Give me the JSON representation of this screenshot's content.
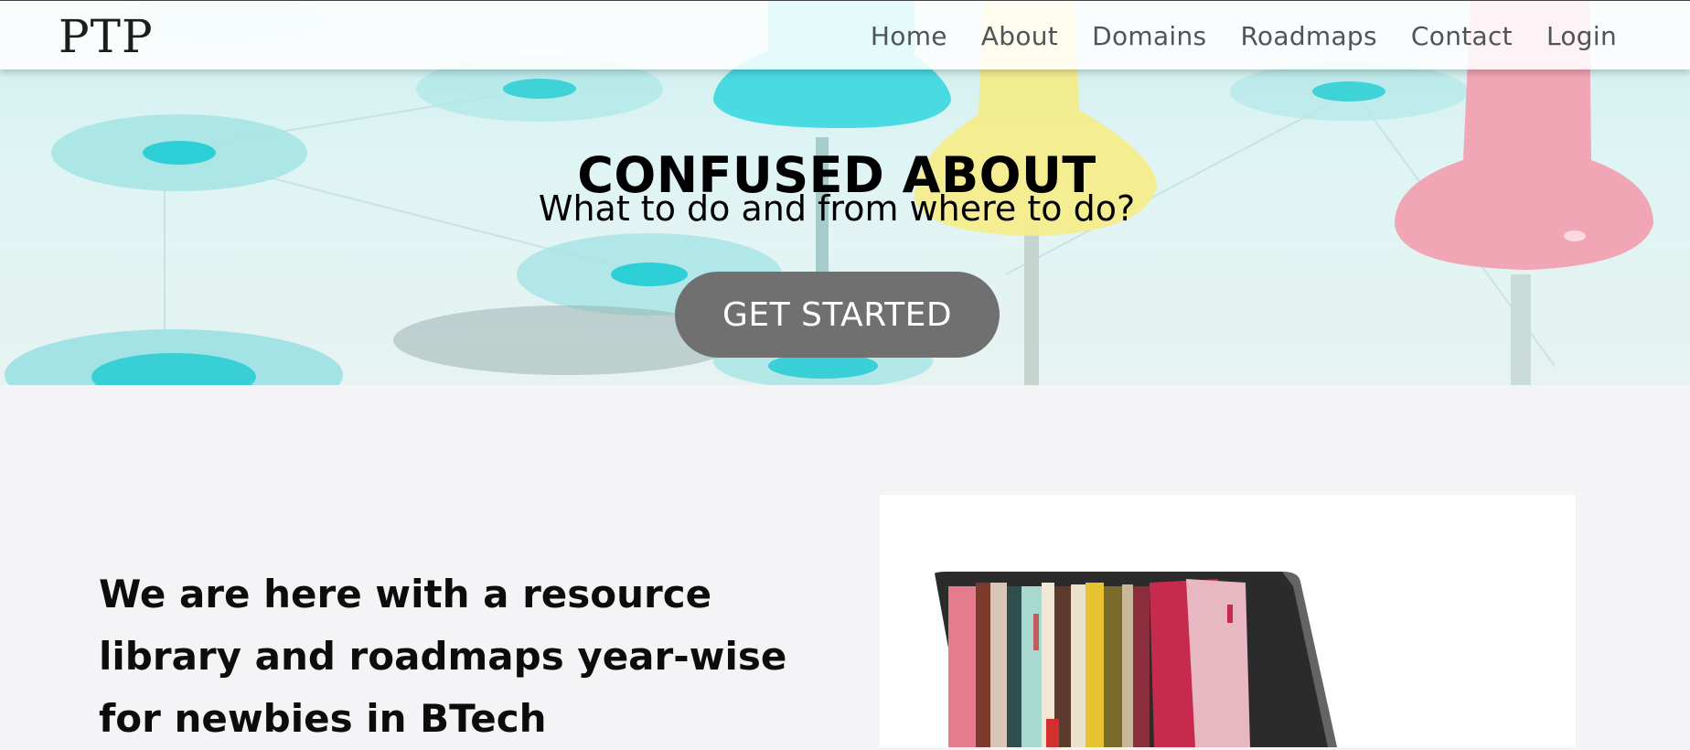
{
  "brand": {
    "logo": "PTP"
  },
  "nav": {
    "items": [
      {
        "label": "Home"
      },
      {
        "label": "About"
      },
      {
        "label": "Domains"
      },
      {
        "label": "Roadmaps"
      },
      {
        "label": "Contact"
      },
      {
        "label": "Login"
      }
    ]
  },
  "hero": {
    "title": "CONFUSED ABOUT",
    "subtitle": "What to do and from where to do?",
    "cta_label": "GET STARTED"
  },
  "about": {
    "heading_lines": [
      "We are here with a resource",
      "library and roadmaps year-wise",
      "for newbies in BTech"
    ]
  },
  "colors": {
    "cta_bg": "#707070",
    "page_bg": "#f4f4f6",
    "nav_text": "#505456"
  }
}
